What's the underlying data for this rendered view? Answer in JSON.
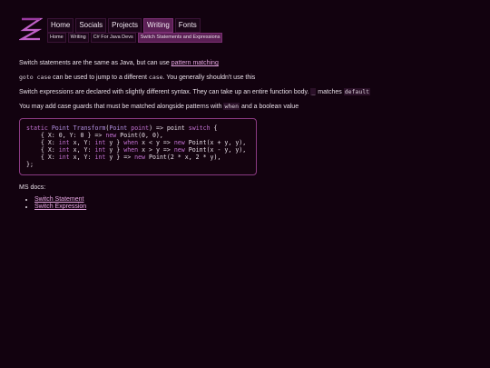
{
  "nav": [
    "Home",
    "Socials",
    "Projects",
    "Writing",
    "Fonts"
  ],
  "nav_active": 3,
  "breadcrumbs": [
    "Home",
    "Writing",
    "C# For Java Devs",
    "Switch Statements and Expressions"
  ],
  "p1": {
    "text": "Switch statements are the same as Java, but can use ",
    "link": "pattern matching"
  },
  "p2": {
    "code": "goto case",
    "text1": " can be used to jump to a different ",
    "code2": "case",
    "text2": ". You generally shouldn't use this"
  },
  "p3": {
    "text1": "Switch expressions are declared with slightly different syntax. They can take up an entire function body. ",
    "code1": "_",
    "text2": " matches ",
    "code2": "default"
  },
  "p4": {
    "text1": "You may add case guards that must be matched alongside patterns with ",
    "code": "when",
    "text2": " and a boolean value"
  },
  "code_lines": [
    "static Point Transform(Point point) => point switch {",
    "    { X: 0, Y: 0 } => new Point(0, 0),",
    "    { X: int x, Y: int y } when x < y => new Point(x + y, y),",
    "    { X: int x, Y: int y } when x > y => new Point(x - y, y),",
    "    { X: int x, Y: int y } => new Point(2 * x, 2 * y),",
    "};"
  ],
  "ms_docs": "MS docs:",
  "doc_links": [
    "Switch Statement",
    "Switch Expression"
  ],
  "colors": {
    "background": "#12020f",
    "accent": "#5a1f54",
    "border": "#8a3a82",
    "link": "#e8a8e4"
  }
}
